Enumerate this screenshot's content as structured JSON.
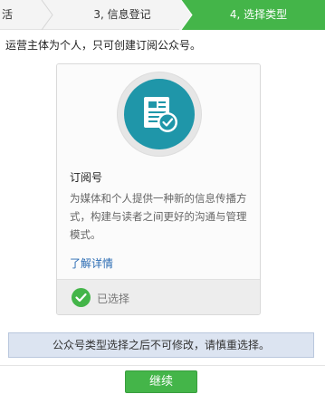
{
  "steps": {
    "step1_label": "活",
    "step2_label": "3, 信息登记",
    "step3_label": "4, 选择类型"
  },
  "intro_text": "运营主体为个人，只可创建订阅公众号。",
  "card": {
    "icon": "subscription-document-check-icon",
    "title": "订阅号",
    "description": "为媒体和个人提供一种新的信息传播方式，构建与读者之间更好的沟通与管理模式。",
    "link_label": "了解详情",
    "selected_label": "已选择"
  },
  "notice_text": "公众号类型选择之后不可修改，请慎重选择。",
  "continue_label": "继续",
  "colors": {
    "accent_green": "#44b549",
    "icon_teal": "#1f96a9",
    "link_blue": "#2a6bb3",
    "notice_bg": "#dce4f1"
  }
}
